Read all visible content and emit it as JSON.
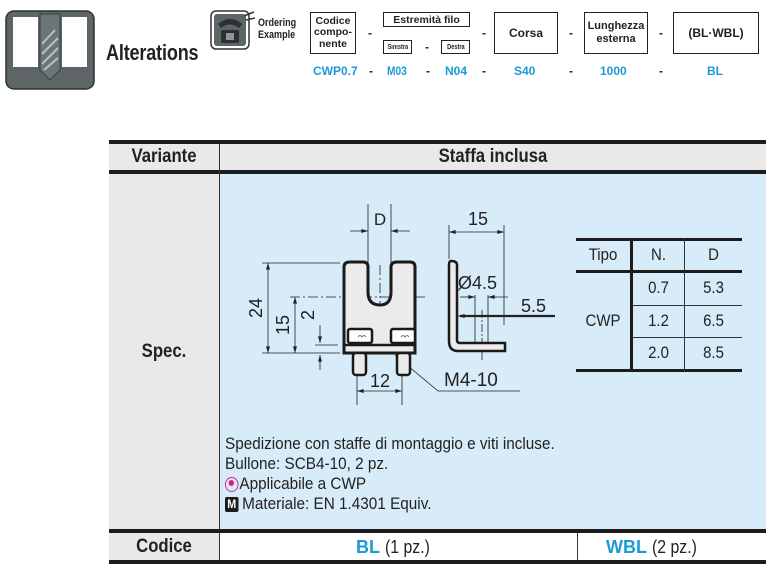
{
  "header": {
    "logo_icon": "drill-bit-icon",
    "title": "Alterations",
    "ordering_icon": "telephone-icon",
    "ordering_label_line1": "Ordering",
    "ordering_label_line2": "Example"
  },
  "ordering_example": {
    "boxes": {
      "codice": [
        "Codice",
        "compo-",
        "nente"
      ],
      "estremita": "Estremità filo",
      "sinistra": "Sinistra",
      "destra": "Destra",
      "corsa": "Corsa",
      "lunghezza": [
        "Lunghezza",
        "esterna"
      ],
      "blwbl": "(BL·WBL)"
    },
    "separator": "-",
    "values": {
      "codice": "CWP0.7",
      "sinistra": "M03",
      "destra": "N04",
      "corsa": "S40",
      "lunghezza": "1000",
      "blwbl": "BL"
    }
  },
  "table": {
    "header": {
      "label": "Variante",
      "value": "Staffa inclusa"
    },
    "spec_label": "Spec.",
    "drawing": {
      "dim_D": "D",
      "dim_15_top": "15",
      "dim_24": "24",
      "dim_15_side": "15",
      "dim_2": "2",
      "dim_12": "12",
      "dim_hole": "Ø4.5",
      "dim_5_5": "5.5",
      "screw_label": "M4-10"
    },
    "spec_table": {
      "headers": [
        "Tipo",
        "N.",
        "D"
      ],
      "tipo": "CWP",
      "rows": [
        {
          "n": "0.7",
          "d": "5.3"
        },
        {
          "n": "1.2",
          "d": "6.5"
        },
        {
          "n": "2.0",
          "d": "8.5"
        }
      ]
    },
    "notes": {
      "line1": "Spedizione con staffe di montaggio e viti incluse.",
      "line2": "Bullone: SCB4-10, 2 pz.",
      "line3": "Applicabile a CWP",
      "line3_icon": "applicable-pin-icon",
      "line4_icon_glyph": "M",
      "line4": "Materiale: EN 1.4301 Equiv."
    },
    "code_label": "Codice",
    "codes": [
      {
        "code": "BL",
        "qty": "(1 pz.)"
      },
      {
        "code": "WBL",
        "qty": "(2 pz.)"
      }
    ]
  },
  "colors": {
    "accent_blue": "#1a9ad6",
    "spec_bg": "#d7ebf8",
    "label_bg": "#e9e9e9",
    "pin_magenta": "#d6217f"
  }
}
